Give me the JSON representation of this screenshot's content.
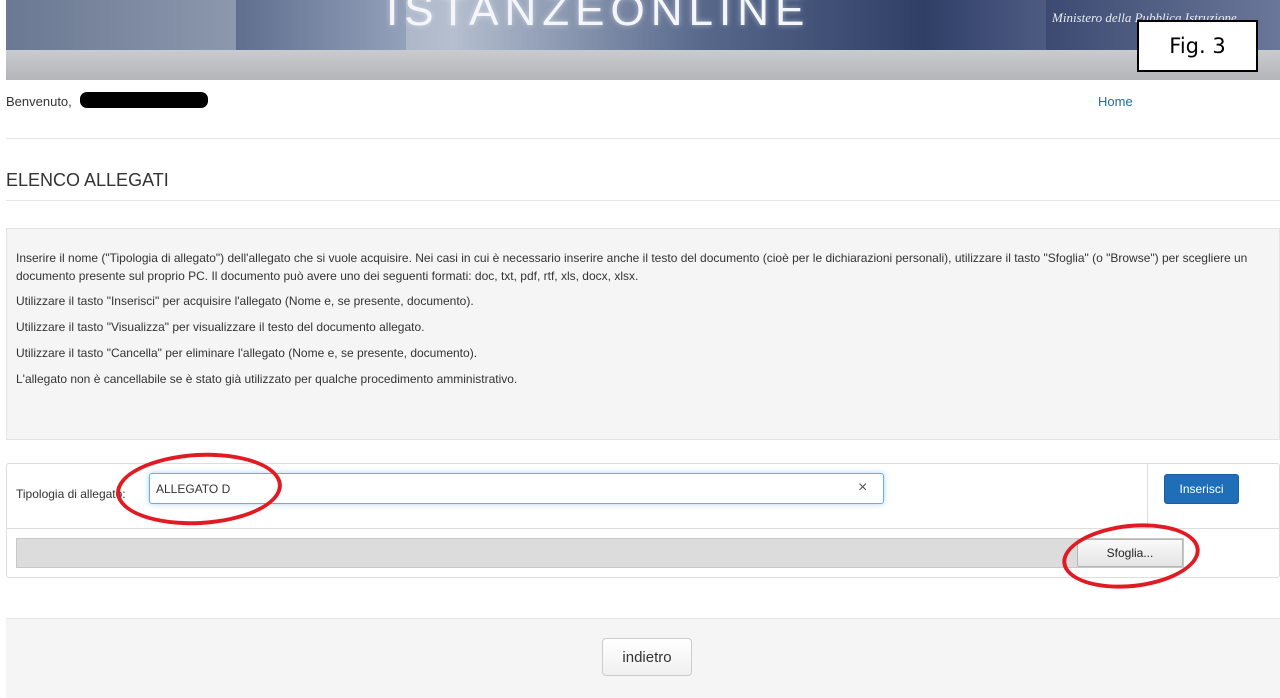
{
  "banner": {
    "logo_text": "ISTANZEONLINE",
    "ministry_text": "Ministero della Pubblica Istruzione",
    "figure_label": "Fig. 3"
  },
  "header": {
    "welcome": "Benvenuto,",
    "home_link": "Home"
  },
  "page": {
    "title": "ELENCO ALLEGATI"
  },
  "info": {
    "paragraphs": [
      "Inserire il nome (\"Tipologia di allegato\") dell'allegato che si vuole acquisire. Nei casi in cui è necessario inserire anche il testo del documento (cioè per le dichiarazioni personali), utilizzare il tasto \"Sfoglia\" (o \"Browse\") per scegliere un documento presente sul proprio PC. Il documento può avere uno dei seguenti formati: doc, txt, pdf, rtf, xls, docx, xlsx.",
      "Utilizzare il tasto \"Inserisci\" per acquisire l'allegato (Nome e, se presente, documento).",
      "Utilizzare il tasto \"Visualizza\" per visualizzare il testo del documento allegato.",
      "Utilizzare il tasto \"Cancella\" per eliminare l'allegato (Nome e, se presente, documento).",
      "L'allegato non è cancellabile se è stato già utilizzato per qualche procedimento amministrativo."
    ]
  },
  "form": {
    "label": "Tipologia di allegato:",
    "value": "ALLEGATO D",
    "clear_glyph": "×",
    "insert_button": "Inserisci",
    "browse_button": "Sfoglia..."
  },
  "footer": {
    "back_button": "indietro"
  },
  "colors": {
    "primary_button": "#1f6fb8",
    "link": "#1a6fa8",
    "annotation": "#e01b24"
  },
  "icons": {
    "clear": "close-icon"
  }
}
